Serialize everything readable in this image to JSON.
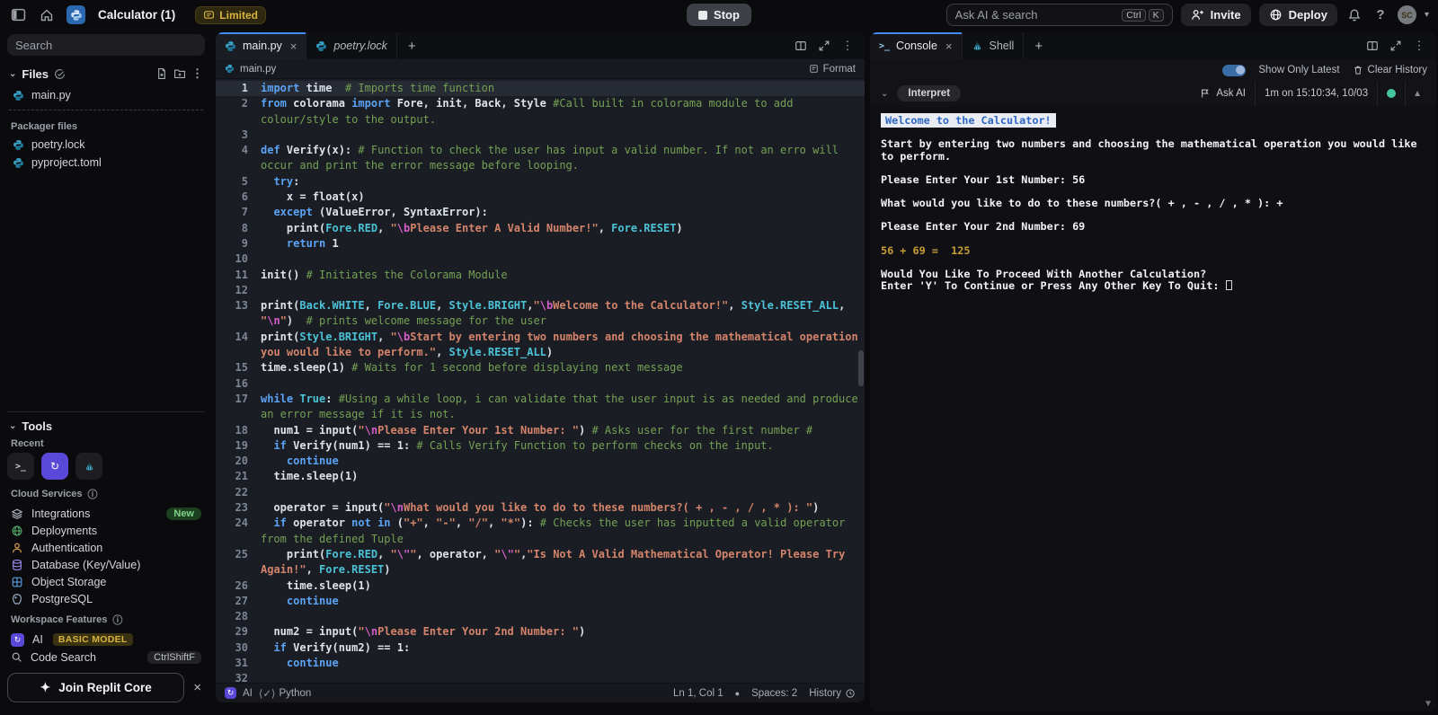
{
  "topbar": {
    "title": "Calculator (1)",
    "limited_badge": "Limited",
    "stop_label": "Stop",
    "search_placeholder": "Ask AI & search",
    "search_keys": [
      "Ctrl",
      "K"
    ],
    "invite_label": "Invite",
    "deploy_label": "Deploy",
    "avatar_initials": "SC"
  },
  "sidebar": {
    "search_placeholder": "Search",
    "files": {
      "header": "Files",
      "items": [
        "main.py"
      ],
      "packager_label": "Packager files",
      "packager_items": [
        "poetry.lock",
        "pyproject.toml"
      ]
    },
    "tools": {
      "header": "Tools",
      "recent_label": "Recent",
      "recent_buttons": [
        {
          "icon": "terminal-icon"
        },
        {
          "icon": "ai-icon",
          "purple": true
        },
        {
          "icon": "shell-icon"
        }
      ],
      "cloud_label": "Cloud Services",
      "cloud_items": [
        {
          "label": "Integrations",
          "icon": "layers-icon",
          "badge": "New"
        },
        {
          "label": "Deployments",
          "icon": "deploy-icon"
        },
        {
          "label": "Authentication",
          "icon": "person-icon"
        },
        {
          "label": "Database (Key/Value)",
          "icon": "database-icon"
        },
        {
          "label": "Object Storage",
          "icon": "grid-icon"
        },
        {
          "label": "PostgreSQL",
          "icon": "postgres-icon"
        }
      ],
      "workspace_label": "Workspace Features",
      "workspace_items": [
        {
          "label": "AI",
          "icon": "ai-icon",
          "badge": "BASIC MODEL"
        },
        {
          "label": "Code Search",
          "icon": "search-icon",
          "shortcut": "CtrlShiftF"
        }
      ]
    },
    "join_core_label": "Join Replit Core"
  },
  "editor": {
    "tabs": [
      {
        "label": "main.py",
        "active": true,
        "closable": true
      },
      {
        "label": "poetry.lock",
        "italic": true
      }
    ],
    "breadcrumb": "main.py",
    "format_label": "Format",
    "status": {
      "ai": "AI",
      "lsp": "⟨✓⟩",
      "lang": "Python",
      "ln": "Ln 1, Col 1",
      "spaces": "Spaces: 2",
      "history": "History"
    },
    "code_lines": [
      {
        "n": 1,
        "segs": [
          [
            "k",
            "import"
          ],
          [
            "d",
            " time  "
          ],
          [
            "c",
            "# Imports time function"
          ]
        ]
      },
      {
        "n": 2,
        "segs": [
          [
            "k",
            "from"
          ],
          [
            "d",
            " colorama "
          ],
          [
            "k",
            "import"
          ],
          [
            "d",
            " Fore, init, Back, Style "
          ],
          [
            "c",
            "#Call built in colorama module to add colour/style to the output."
          ]
        ]
      },
      {
        "n": 3,
        "segs": []
      },
      {
        "n": 4,
        "segs": [
          [
            "k",
            "def"
          ],
          [
            "d",
            " Verify(x): "
          ],
          [
            "c",
            "# Function to check the user has input a valid number. If not an erro will occur and print the error message before looping."
          ]
        ]
      },
      {
        "n": 5,
        "segs": [
          [
            "d",
            "  "
          ],
          [
            "k",
            "try"
          ],
          [
            "d",
            ":"
          ]
        ]
      },
      {
        "n": 6,
        "segs": [
          [
            "d",
            "    x = float(x)"
          ]
        ]
      },
      {
        "n": 7,
        "segs": [
          [
            "d",
            "  "
          ],
          [
            "k",
            "except"
          ],
          [
            "d",
            " (ValueError, SyntaxError):"
          ]
        ]
      },
      {
        "n": 8,
        "segs": [
          [
            "d",
            "    print("
          ],
          [
            "t",
            "Fore.RED"
          ],
          [
            "d",
            ", "
          ],
          [
            "s",
            "\""
          ],
          [
            "e",
            "\\b"
          ],
          [
            "s",
            "Please Enter A Valid Number!\""
          ],
          [
            "d",
            ", "
          ],
          [
            "t",
            "Fore.RESET"
          ],
          [
            "d",
            ")"
          ]
        ]
      },
      {
        "n": 9,
        "segs": [
          [
            "d",
            "    "
          ],
          [
            "k",
            "return"
          ],
          [
            "d",
            " 1"
          ]
        ]
      },
      {
        "n": 10,
        "segs": []
      },
      {
        "n": 11,
        "segs": [
          [
            "d",
            "init() "
          ],
          [
            "c",
            "# Initiates the Colorama Module"
          ]
        ]
      },
      {
        "n": 12,
        "segs": []
      },
      {
        "n": 13,
        "segs": [
          [
            "d",
            "print("
          ],
          [
            "t",
            "Back.WHITE"
          ],
          [
            "d",
            ", "
          ],
          [
            "t",
            "Fore.BLUE"
          ],
          [
            "d",
            ", "
          ],
          [
            "t",
            "Style.BRIGHT"
          ],
          [
            "d",
            ","
          ],
          [
            "s",
            "\""
          ],
          [
            "e",
            "\\b"
          ],
          [
            "s",
            "Welcome to the Calculator!\""
          ],
          [
            "d",
            ", "
          ],
          [
            "t",
            "Style.RESET_ALL"
          ],
          [
            "d",
            ", "
          ],
          [
            "s",
            "\""
          ],
          [
            "e",
            "\\n"
          ],
          [
            "s",
            "\""
          ],
          [
            "d",
            ")  "
          ],
          [
            "c",
            "# prints welcome message for the user"
          ]
        ]
      },
      {
        "n": 14,
        "segs": [
          [
            "d",
            "print("
          ],
          [
            "t",
            "Style.BRIGHT"
          ],
          [
            "d",
            ", "
          ],
          [
            "s",
            "\""
          ],
          [
            "e",
            "\\b"
          ],
          [
            "s",
            "Start by entering two numbers and choosing the mathematical operation you would like to perform.\""
          ],
          [
            "d",
            ", "
          ],
          [
            "t",
            "Style.RESET_ALL"
          ],
          [
            "d",
            ")"
          ]
        ]
      },
      {
        "n": 15,
        "segs": [
          [
            "d",
            "time.sleep(1) "
          ],
          [
            "c",
            "# Waits for 1 second before displaying next message"
          ]
        ]
      },
      {
        "n": 16,
        "segs": []
      },
      {
        "n": 17,
        "segs": [
          [
            "k",
            "while"
          ],
          [
            "d",
            " "
          ],
          [
            "t",
            "True"
          ],
          [
            "d",
            ": "
          ],
          [
            "c",
            "#Using a while loop, i can validate that the user input is as needed and produce an error message if it is not."
          ]
        ]
      },
      {
        "n": 18,
        "segs": [
          [
            "d",
            "  num1 = input("
          ],
          [
            "s",
            "\""
          ],
          [
            "e",
            "\\n"
          ],
          [
            "s",
            "Please Enter Your 1st Number: \""
          ],
          [
            "d",
            ") "
          ],
          [
            "c",
            "# Asks user for the first number #"
          ]
        ]
      },
      {
        "n": 19,
        "segs": [
          [
            "d",
            "  "
          ],
          [
            "k",
            "if"
          ],
          [
            "d",
            " Verify(num1) == 1: "
          ],
          [
            "c",
            "# Calls Verify Function to perform checks on the input."
          ]
        ]
      },
      {
        "n": 20,
        "segs": [
          [
            "d",
            "    "
          ],
          [
            "k",
            "continue"
          ]
        ]
      },
      {
        "n": 21,
        "segs": [
          [
            "d",
            "  time.sleep(1)"
          ]
        ]
      },
      {
        "n": 22,
        "segs": []
      },
      {
        "n": 23,
        "segs": [
          [
            "d",
            "  operator = input("
          ],
          [
            "s",
            "\""
          ],
          [
            "e",
            "\\n"
          ],
          [
            "s",
            "What would you like to do to these numbers?( + , - , / , * ): \""
          ],
          [
            "d",
            ")"
          ]
        ]
      },
      {
        "n": 24,
        "segs": [
          [
            "d",
            "  "
          ],
          [
            "k",
            "if"
          ],
          [
            "d",
            " operator "
          ],
          [
            "k",
            "not"
          ],
          [
            "d",
            " "
          ],
          [
            "k",
            "in"
          ],
          [
            "d",
            " ("
          ],
          [
            "s",
            "\"+\""
          ],
          [
            "d",
            ", "
          ],
          [
            "s",
            "\"-\""
          ],
          [
            "d",
            ", "
          ],
          [
            "s",
            "\"/\""
          ],
          [
            "d",
            ", "
          ],
          [
            "s",
            "\"*\""
          ],
          [
            "d",
            "): "
          ],
          [
            "c",
            "# Checks the user has inputted a valid operator from the defined Tuple"
          ]
        ]
      },
      {
        "n": 25,
        "segs": [
          [
            "d",
            "    print("
          ],
          [
            "t",
            "Fore.RED"
          ],
          [
            "d",
            ", "
          ],
          [
            "s",
            "\""
          ],
          [
            "e",
            "\\\""
          ],
          [
            "s",
            "\""
          ],
          [
            "d",
            ", operator, "
          ],
          [
            "s",
            "\""
          ],
          [
            "e",
            "\\\""
          ],
          [
            "s",
            "\""
          ],
          [
            "d",
            ","
          ],
          [
            "s",
            "\"Is Not A Valid Mathematical Operator! Please Try Again!\""
          ],
          [
            "d",
            ", "
          ],
          [
            "t",
            "Fore.RESET"
          ],
          [
            "d",
            ")"
          ]
        ]
      },
      {
        "n": 26,
        "segs": [
          [
            "d",
            "    time.sleep(1)"
          ]
        ]
      },
      {
        "n": 27,
        "segs": [
          [
            "d",
            "    "
          ],
          [
            "k",
            "continue"
          ]
        ]
      },
      {
        "n": 28,
        "segs": []
      },
      {
        "n": 29,
        "segs": [
          [
            "d",
            "  num2 = input("
          ],
          [
            "s",
            "\""
          ],
          [
            "e",
            "\\n"
          ],
          [
            "s",
            "Please Enter Your 2nd Number: \""
          ],
          [
            "d",
            ")"
          ]
        ]
      },
      {
        "n": 30,
        "segs": [
          [
            "d",
            "  "
          ],
          [
            "k",
            "if"
          ],
          [
            "d",
            " Verify(num2) == 1:"
          ]
        ]
      },
      {
        "n": 31,
        "segs": [
          [
            "d",
            "    "
          ],
          [
            "k",
            "continue"
          ]
        ]
      },
      {
        "n": 32,
        "segs": []
      }
    ]
  },
  "console": {
    "tabs": [
      {
        "label": "Console",
        "icon": "terminal-icon",
        "active": true,
        "closable": true
      },
      {
        "label": "Shell",
        "icon": "shell-icon"
      }
    ],
    "show_only_latest": "Show Only Latest",
    "clear_history": "Clear History",
    "interpret_label": "Interpret",
    "ask_ai": "Ask AI",
    "run_meta": "1m on 15:10:34, 10/03",
    "lines": [
      {
        "style": "banner",
        "text": "Welcome to the Calculator!"
      },
      {
        "style": "bold",
        "text": "Start by entering two numbers and choosing the mathematical operation you would like to perform."
      },
      {
        "style": "bold",
        "text": "Please Enter Your 1st Number: 56"
      },
      {
        "style": "bold",
        "text": "What would you like to do to these numbers?( + , - , / , * ): +"
      },
      {
        "style": "bold",
        "text": "Please Enter Your 2nd Number: 69"
      },
      {
        "style": "gold",
        "text": "56 + 69 =  125"
      },
      {
        "style": "bold",
        "tight": true,
        "text": "Would You Like To Proceed With Another Calculation?"
      },
      {
        "style": "bold",
        "cursor": true,
        "text": "Enter 'Y' To Continue or Press Any Other Key To Quit: "
      }
    ]
  },
  "colors": {
    "accent_blue": "#3f8cfa",
    "keyword": "#5ba3f5",
    "string": "#d4846a",
    "comment": "#74a154",
    "teal": "#4cc2d6",
    "escape": "#d45fc8",
    "gold": "#c79d38",
    "banner_bg": "#e9edf3",
    "banner_fg": "#2e66c4",
    "green_dot": "#43c59e"
  }
}
